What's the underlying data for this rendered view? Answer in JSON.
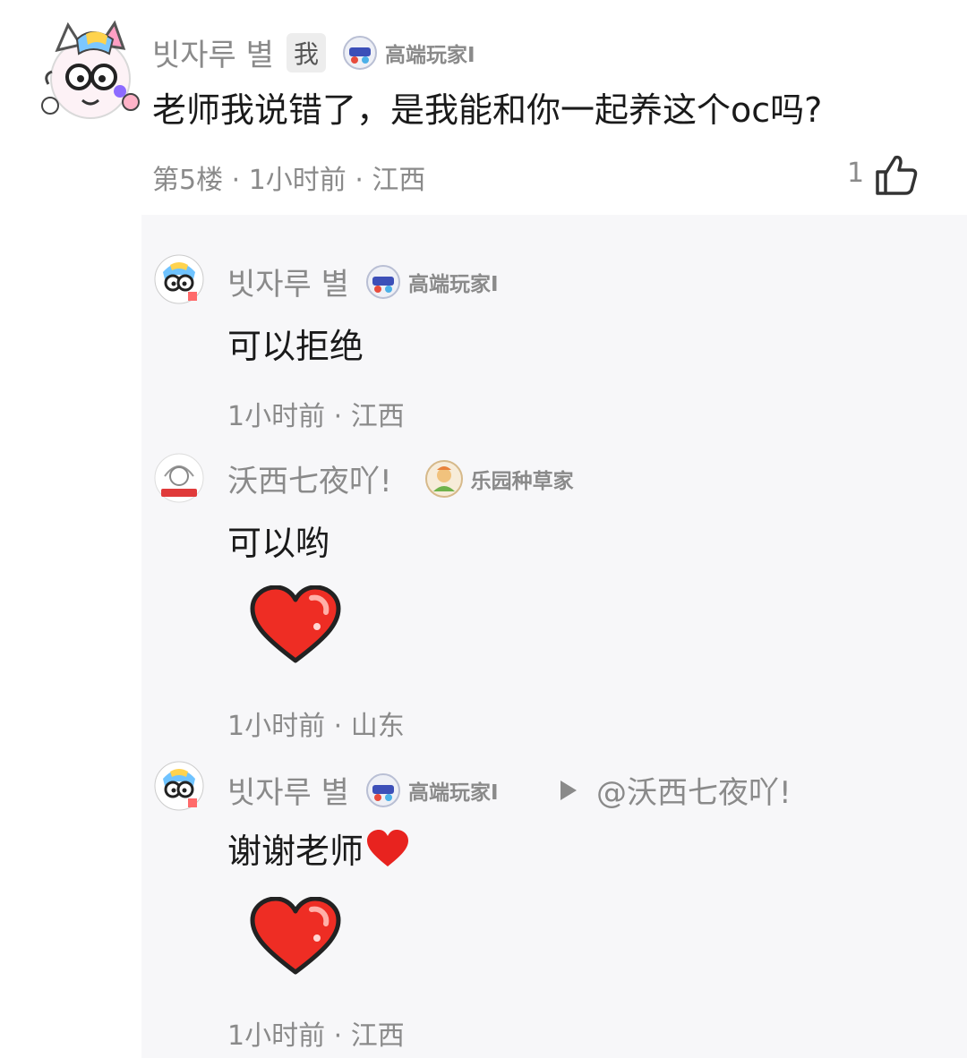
{
  "main_comment": {
    "username": "빗자루 별",
    "me_badge": "我",
    "badge_label": "高端玩家Ⅰ",
    "text": "老师我说错了，是我能和你一起养这个oc吗?",
    "meta": "第5楼 · 1小时前 · 江西",
    "like_count": "1",
    "icons": {
      "avatar": "cat-avatar-icon",
      "badge": "badge-icon",
      "like": "thumbs-up-icon"
    }
  },
  "replies": [
    {
      "username": "빗자루 별",
      "badge_label": "高端玩家Ⅰ",
      "text": "可以拒绝",
      "meta": "1小时前 · 江西"
    },
    {
      "username": "沃西七夜吖!",
      "badge_label": "乐园种草家",
      "text": "可以哟",
      "sticker": "heart-sticker-icon",
      "meta": "1小时前 · 山东"
    },
    {
      "username": "빗자루 별",
      "badge_label": "高端玩家Ⅰ",
      "reply_to": "@沃西七夜吖!",
      "text": "谢谢老师",
      "sticker": "heart-sticker-icon",
      "meta": "1小时前 · 江西"
    }
  ],
  "colors": {
    "panel_bg": "#f7f7f9",
    "meta_gray": "#8a8a8a",
    "heart_red": "#e8231f"
  }
}
